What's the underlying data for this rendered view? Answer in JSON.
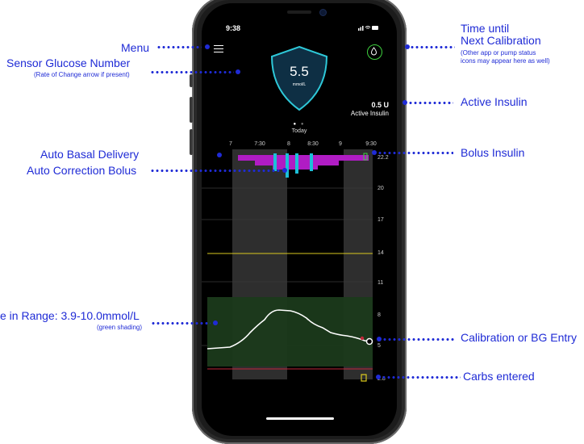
{
  "status_bar": {
    "time": "9:38",
    "icons": "..ıl ≋ ▬"
  },
  "sensor": {
    "value": "5.5",
    "unit": "mmol/L"
  },
  "active_insulin": {
    "value": "0.5 U",
    "label": "Active Insulin"
  },
  "date_label": "Today",
  "graph": {
    "x_ticks": [
      "7",
      "7:30",
      "8",
      "8:30",
      "9",
      "9:30"
    ],
    "y_ticks": [
      "22.2",
      "20",
      "17",
      "14",
      "11",
      "8",
      "5",
      "2.8"
    ]
  },
  "annotations": {
    "menu": "Menu",
    "sensor_glucose": "Sensor Glucose Number",
    "sensor_glucose_sub": "(Rate of Change arrow if present)",
    "auto_basal": "Auto Basal Delivery",
    "auto_correction": "Auto Correction Bolus",
    "range": "e in Range: 3.9-10.0mmol/L",
    "range_sub": "(green shading)",
    "calibration_title1": "Time until",
    "calibration_title2": "Next Calibration",
    "calibration_sub1": "(Other app or pump status",
    "calibration_sub2": "icons may appear here as well)",
    "active_insulin": "Active Insulin",
    "bolus_insulin": "Bolus Insulin",
    "calibration_bg": "Calibration or BG Entry",
    "carbs": "Carbs entered"
  },
  "colors": {
    "annotation": "#1f2bd6",
    "range_fill": "#1a3a1a",
    "basal": "#b01cc4",
    "bolus": "#1cc0d8",
    "calibration_icon": "#3ed13e",
    "high_limit": "#d9c81e",
    "low_limit": "#c0283a"
  }
}
